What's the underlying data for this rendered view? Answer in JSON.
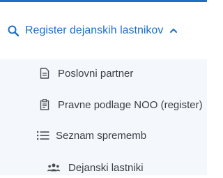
{
  "menu": {
    "title": "Register dejanskih lastnikov",
    "icons": {
      "search": "search-icon",
      "chevron": "chevron-up-icon"
    },
    "items": [
      {
        "label": "Poslovni partner",
        "icon": "document-icon"
      },
      {
        "label": "Pravne podlage NOO (register)",
        "icon": "clipboard-icon"
      },
      {
        "label": "Seznam sprememb",
        "icon": "list-icon"
      },
      {
        "label": "Dejanski lastniki",
        "icon": "users-icon"
      }
    ]
  },
  "colors": {
    "accent": "#1c6fc6",
    "text": "#3b3f44",
    "submenu_bg": "#f4f7fb"
  }
}
